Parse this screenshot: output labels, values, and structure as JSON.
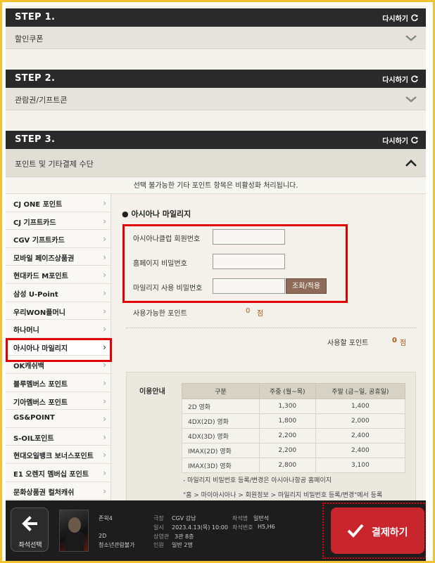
{
  "steps": [
    {
      "title": "STEP 1.",
      "retry": "다시하기",
      "section": "할인쿠폰",
      "expanded": false
    },
    {
      "title": "STEP 2.",
      "retry": "다시하기",
      "section": "관람권/기프트콘",
      "expanded": false
    },
    {
      "title": "STEP 3.",
      "retry": "다시하기",
      "section": "포인트 및 기타결제 수단",
      "expanded": true
    }
  ],
  "notice": "선택 불가능한 기타 포인트 항목은 비활성화 처리됩니다.",
  "payment_methods": [
    "CJ ONE 포인트",
    "CJ 기프트카드",
    "CGV 기프트카드",
    "모바일 페이즈상품권",
    "현대카드 M포인트",
    "삼성 U-Point",
    "우리WON플머니",
    "하나머니",
    "아시아나 마일리지",
    "OK캐쉬백",
    "블루멤버스 포인트",
    "기아멤버스 포인트",
    "GS&POINT",
    "S-OIL포인트",
    "현대오일뱅크 보너스포인트",
    "E1 오렌지 멤버십 포인트",
    "문화상품권 컬처캐쉬"
  ],
  "selected_method": "아시아나 마일리지",
  "asiana": {
    "title": "아시아나 마일리지",
    "member_label": "아시아나클럽 회원번호",
    "member_value": "",
    "homepage_pw_label": "홈페이지 비밀번호",
    "homepage_pw_value": "",
    "mileage_pw_label": "마일리지 사용 비밀번호",
    "mileage_pw_value": "",
    "lookup_button": "조회/적용",
    "available_label": "사용가능한 포인트",
    "available_value": "0",
    "available_unit": "점",
    "use_label": "사용할 포인트",
    "use_value": "0",
    "use_unit": "점"
  },
  "guide": {
    "title": "이용안내",
    "headers": [
      "구분",
      "주중 (월~목)",
      "주말 (금~일, 공휴일)"
    ],
    "rows": [
      [
        "2D 영화",
        "1,300",
        "1,400"
      ],
      [
        "4DX(2D) 영화",
        "1,800",
        "2,000"
      ],
      [
        "4DX(3D) 영화",
        "2,200",
        "2,400"
      ],
      [
        "IMAX(2D) 영화",
        "2,200",
        "2,400"
      ],
      [
        "IMAX(3D) 영화",
        "2,800",
        "3,100"
      ]
    ],
    "note1": "- 마일리지 비밀번호 등록/변경은 아시아나항공 홈페이지",
    "note2": "\"홈 > 마이아시아나 > 회원정보 > 마일리지 비밀번호 등록/변경\"에서 등록"
  },
  "bottom": {
    "back_label": "좌석선택",
    "movie_title": "존윅4",
    "movie_format": "2D",
    "movie_rating": "청소년관람불가",
    "theater_label": "극장",
    "theater_value": "CGV 강남",
    "date_label": "일시",
    "date_value": "2023.4.13(목) 10:00",
    "screen_label": "상영관",
    "screen_value": "3관 8층",
    "people_label": "인원",
    "people_value": "일반 2명",
    "seat_type_label": "좌석명",
    "seat_type_value": "일반석",
    "seat_no_label": "좌석번호",
    "seat_no_value": "H5,H6",
    "pay_label": "결제하기"
  },
  "colors": {
    "accent": "#c9252c",
    "highlight": "#e00000",
    "frame": "#f1c232",
    "point_value": "#b05a1a"
  }
}
